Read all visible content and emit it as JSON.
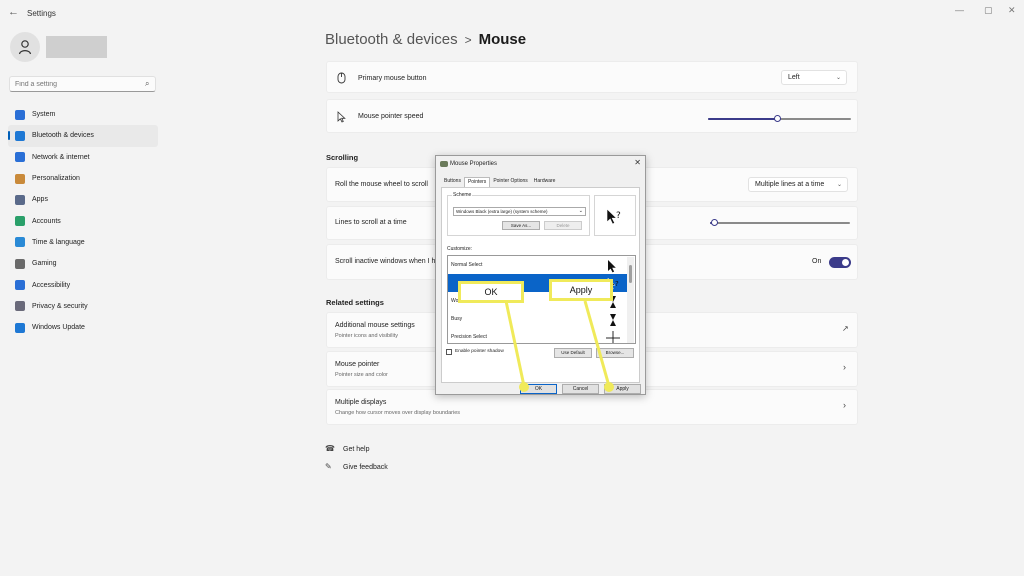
{
  "app": {
    "title": "Settings",
    "back_icon": "back-arrow-icon",
    "controls": [
      "minimize",
      "maximize",
      "close"
    ]
  },
  "sidebar": {
    "search_placeholder": "Find a setting",
    "items": [
      {
        "label": "System",
        "icon": "system-icon",
        "color": "#2a6fd6"
      },
      {
        "label": "Bluetooth & devices",
        "icon": "bluetooth-icon",
        "color": "#1e78d4"
      },
      {
        "label": "Network & internet",
        "icon": "network-icon",
        "color": "#2a6fd6"
      },
      {
        "label": "Personalization",
        "icon": "brush-icon",
        "color": "#c98a3a"
      },
      {
        "label": "Apps",
        "icon": "apps-icon",
        "color": "#5a6a8a"
      },
      {
        "label": "Accounts",
        "icon": "accounts-icon",
        "color": "#2aa06a"
      },
      {
        "label": "Time & language",
        "icon": "globe-icon",
        "color": "#2a8ad6"
      },
      {
        "label": "Gaming",
        "icon": "gaming-icon",
        "color": "#6a6a6a"
      },
      {
        "label": "Accessibility",
        "icon": "accessibility-icon",
        "color": "#2a6fd6"
      },
      {
        "label": "Privacy & security",
        "icon": "shield-icon",
        "color": "#6a6a7a"
      },
      {
        "label": "Windows Update",
        "icon": "update-icon",
        "color": "#1e78d4"
      }
    ],
    "active_index": 1
  },
  "header": {
    "parent": "Bluetooth & devices",
    "separator": ">",
    "current": "Mouse"
  },
  "settings": {
    "primary_button": {
      "label": "Primary mouse button",
      "value": "Left"
    },
    "pointer_speed": {
      "label": "Mouse pointer speed",
      "level": 0.48
    },
    "scrolling_heading": "Scrolling",
    "roll_wheel": {
      "label": "Roll the mouse wheel to scroll",
      "value": "Multiple lines at a time"
    },
    "lines_to_scroll": {
      "label": "Lines to scroll at a time",
      "level": 0.03
    },
    "scroll_inactive": {
      "label": "Scroll inactive windows when I hover over them",
      "toggle_text": "On"
    },
    "related_heading": "Related settings",
    "additional": {
      "label": "Additional mouse settings",
      "sub": "Pointer icons and visibility"
    },
    "pointer": {
      "label": "Mouse pointer",
      "sub": "Pointer size and color"
    },
    "displays": {
      "label": "Multiple displays",
      "sub": "Change how cursor moves over display boundaries"
    },
    "get_help": "Get help",
    "give_feedback": "Give feedback"
  },
  "dialog": {
    "title": "Mouse Properties",
    "tabs": [
      "Buttons",
      "Pointers",
      "Pointer Options",
      "Hardware"
    ],
    "active_tab": 1,
    "scheme_label": "Scheme",
    "scheme_value": "Windows Black (extra large) (system scheme)",
    "save_as": "Save As...",
    "delete": "Delete",
    "customize_label": "Customize:",
    "cursors": [
      "Normal Select",
      "",
      "Wo",
      "Busy",
      "Precision Select"
    ],
    "selected_cursor_index": 1,
    "enable_shadow": "Enable pointer shadow",
    "use_default": "Use Default",
    "browse": "Browse...",
    "ok": "OK",
    "cancel": "Cancel",
    "apply": "Apply"
  },
  "callouts": {
    "ok": "OK",
    "apply": "Apply",
    "color": "#f0ea5a"
  }
}
